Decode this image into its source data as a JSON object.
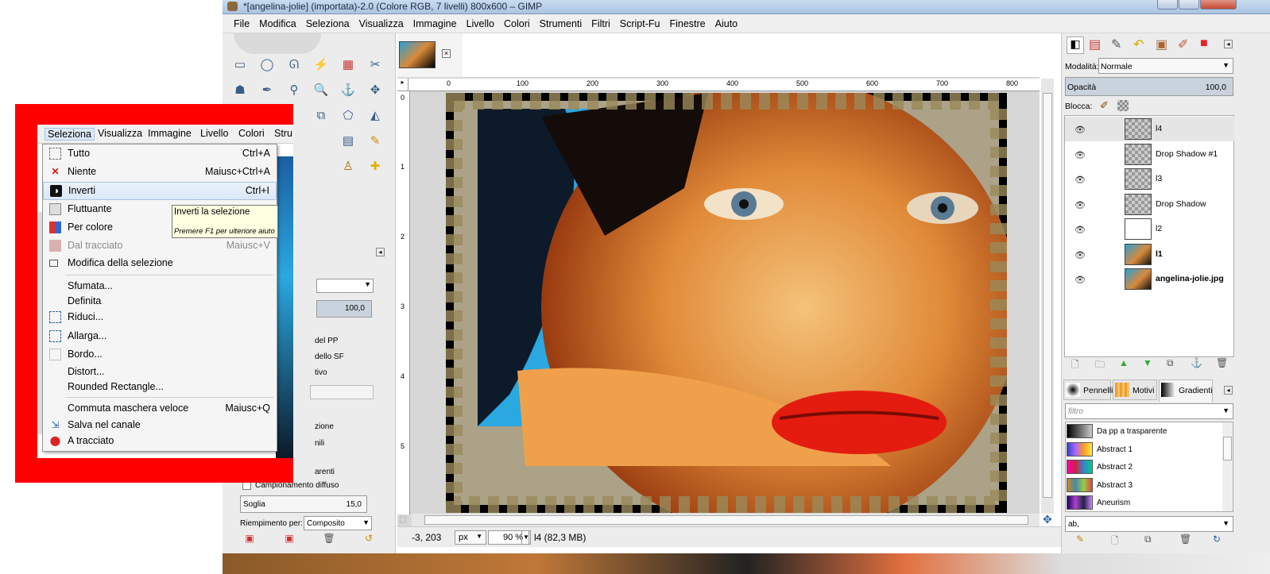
{
  "window": {
    "title": "*[angelina-jolie] (importata)-2.0 (Colore RGB, 7 livelli) 800x600 – GIMP"
  },
  "menubar": [
    "File",
    "Modifica",
    "Seleziona",
    "Visualizza",
    "Immagine",
    "Livello",
    "Colori",
    "Strumenti",
    "Filtri",
    "Script-Fu",
    "Finestre",
    "Aiuto"
  ],
  "ruler": {
    "h_ticks": [
      "0",
      "100",
      "200",
      "300",
      "400",
      "500",
      "600",
      "700",
      "800"
    ],
    "v_ticks": [
      "0",
      "1",
      "2",
      "3",
      "4",
      "5"
    ]
  },
  "statusbar": {
    "coords": "-3, 203",
    "unit": "px",
    "zoom": "90 %",
    "layer_info": "l4 (82,3 MB)"
  },
  "tooloptions": {
    "opacity_value": "100,0",
    "opt1": "del PP",
    "opt2": "dello SF",
    "opt3": "tivo",
    "opt4": "zione",
    "opt5": "nili",
    "opt6": "arenti",
    "diffuse": "Campionamento diffuso",
    "threshold_label": "Soglia",
    "threshold_value": "15,0",
    "fill_label": "Riempimento per:",
    "fill_value": "Composito"
  },
  "layers_panel": {
    "mode_label": "Modalità:",
    "mode_value": "Normale",
    "opacity_label": "Opacità",
    "opacity_value": "100,0",
    "lock_label": "Blocca:",
    "layers": [
      {
        "name": "l4",
        "bold": false
      },
      {
        "name": "Drop Shadow #1",
        "bold": false
      },
      {
        "name": "l3",
        "bold": false
      },
      {
        "name": "Drop Shadow",
        "bold": false
      },
      {
        "name": "l2",
        "bold": false
      },
      {
        "name": "l1",
        "bold": true
      },
      {
        "name": "angelina-jolie.jpg",
        "bold": true
      }
    ]
  },
  "brushes_panel": {
    "tabs": [
      "Pennelli",
      "Motivi",
      "Gradienti"
    ],
    "filter_placeholder": "filtro",
    "gradients": [
      "Da pp a trasparente",
      "Abstract 1",
      "Abstract 2",
      "Abstract 3",
      "Aneurism"
    ],
    "tag_value": "ab,"
  },
  "zoom_inset": {
    "menubar": [
      "Seleziona",
      "Visualizza",
      "Immagine",
      "Livello",
      "Colori",
      "Stru"
    ],
    "items": [
      {
        "label": "Tutto",
        "shortcut": "Ctrl+A",
        "icon": "select-all-icon",
        "disabled": false
      },
      {
        "label": "Niente",
        "shortcut": "Maiusc+Ctrl+A",
        "icon": "select-none-icon",
        "disabled": false
      },
      {
        "label": "Inverti",
        "shortcut": "Ctrl+I",
        "icon": "invert-icon",
        "disabled": false,
        "highlight": true
      },
      {
        "label": "Fluttuante",
        "shortcut": "",
        "icon": "float-icon",
        "disabled": false
      },
      {
        "label": "Per colore",
        "shortcut": "",
        "icon": "by-color-icon",
        "disabled": false
      },
      {
        "label": "Dal tracciato",
        "shortcut": "Maiusc+V",
        "icon": "from-path-icon",
        "disabled": true
      },
      {
        "label": "Modifica della selezione",
        "shortcut": "",
        "icon": "edit-selection-icon",
        "disabled": false
      },
      {
        "label": "Sfumata...",
        "shortcut": "",
        "icon": "",
        "disabled": false
      },
      {
        "label": "Definita",
        "shortcut": "",
        "icon": "",
        "disabled": false
      },
      {
        "label": "Riduci...",
        "shortcut": "",
        "icon": "shrink-icon",
        "disabled": false
      },
      {
        "label": "Allarga...",
        "shortcut": "",
        "icon": "grow-icon",
        "disabled": false
      },
      {
        "label": "Bordo...",
        "shortcut": "",
        "icon": "border-icon",
        "disabled": false
      },
      {
        "label": "Distort...",
        "shortcut": "",
        "icon": "",
        "disabled": false
      },
      {
        "label": "Rounded Rectangle...",
        "shortcut": "",
        "icon": "",
        "disabled": false
      },
      {
        "label": "Commuta maschera veloce",
        "shortcut": "Maiusc+Q",
        "icon": "",
        "disabled": false
      },
      {
        "label": "Salva nel canale",
        "shortcut": "",
        "icon": "save-channel-icon",
        "disabled": false
      },
      {
        "label": "A tracciato",
        "shortcut": "",
        "icon": "to-path-icon",
        "disabled": false
      }
    ],
    "tooltip": {
      "title": "Inverti la selezione",
      "hint": "Premere F1 per ulteriore aiuto"
    }
  }
}
